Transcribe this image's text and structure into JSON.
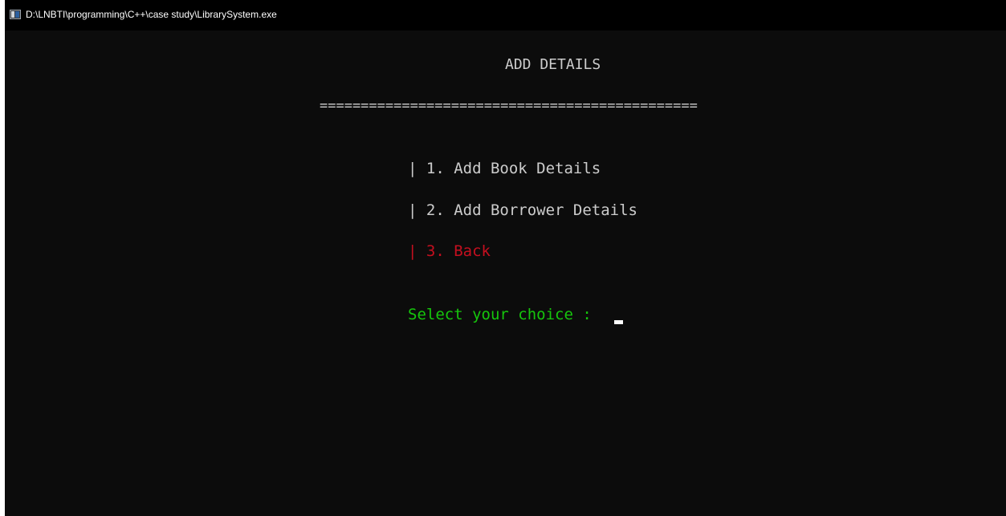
{
  "window": {
    "title": "D:\\LNBTI\\programming\\C++\\case study\\LibrarySystem.exe",
    "icon": "console-app-icon"
  },
  "console": {
    "heading": "ADD DETAILS",
    "divider": "==============================================",
    "options": [
      {
        "label": "| 1. Add Book Details"
      },
      {
        "label": "| 2. Add Borrower Details"
      },
      {
        "label": "| 3. Back"
      }
    ],
    "prompt": "Select your choice :"
  },
  "colors": {
    "background": "#0c0c0c",
    "text": "#cccccc",
    "back_option": "#c50f1f",
    "prompt": "#16c60c",
    "cursor": "#ffffff"
  }
}
